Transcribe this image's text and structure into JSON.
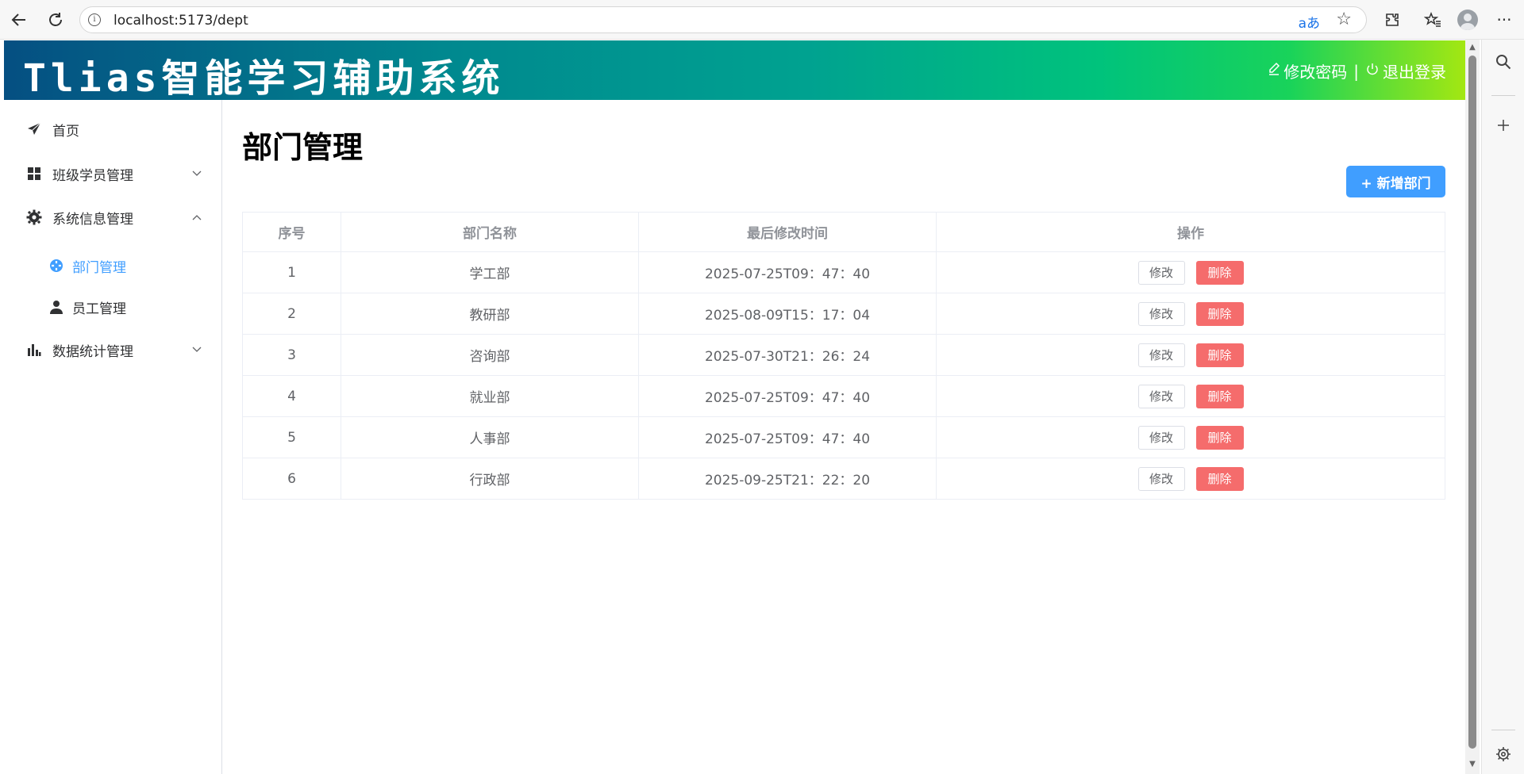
{
  "browser": {
    "url": "localhost:5173/dept",
    "translate_label": "aあ",
    "info_label": "i"
  },
  "app": {
    "title": "Tlias智能学习辅助系统",
    "change_password": "修改密码",
    "separator": "|",
    "logout": "退出登录"
  },
  "sidebar": {
    "items": [
      {
        "label": "首页",
        "icon": "paper-plane-icon"
      },
      {
        "label": "班级学员管理",
        "icon": "grid-icon",
        "expanded": false
      },
      {
        "label": "系统信息管理",
        "icon": "gear-icon",
        "expanded": true
      },
      {
        "label": "部门管理",
        "icon": "circle-icon",
        "active": true
      },
      {
        "label": "员工管理",
        "icon": "user-icon"
      },
      {
        "label": "数据统计管理",
        "icon": "bar-chart-icon",
        "expanded": false
      }
    ]
  },
  "main": {
    "page_title": "部门管理",
    "add_button": "+ 新增部门",
    "table": {
      "headers": [
        "序号",
        "部门名称",
        "最后修改时间",
        "操作"
      ],
      "rows": [
        {
          "no": "1",
          "name": "学工部",
          "time": "2025-07-25T09：47：40"
        },
        {
          "no": "2",
          "name": "教研部",
          "time": "2025-08-09T15：17：04"
        },
        {
          "no": "3",
          "name": "咨询部",
          "time": "2025-07-30T21：26：24"
        },
        {
          "no": "4",
          "name": "就业部",
          "time": "2025-07-25T09：47：40"
        },
        {
          "no": "5",
          "name": "人事部",
          "time": "2025-07-25T09：47：40"
        },
        {
          "no": "6",
          "name": "行政部",
          "time": "2025-09-25T21：22：20"
        }
      ],
      "edit_label": "修改",
      "delete_label": "删除"
    }
  },
  "colors": {
    "primary": "#409eff",
    "danger": "#f56c6c",
    "header_gradient_start": "#054f82",
    "header_gradient_end": "#a3e712"
  }
}
